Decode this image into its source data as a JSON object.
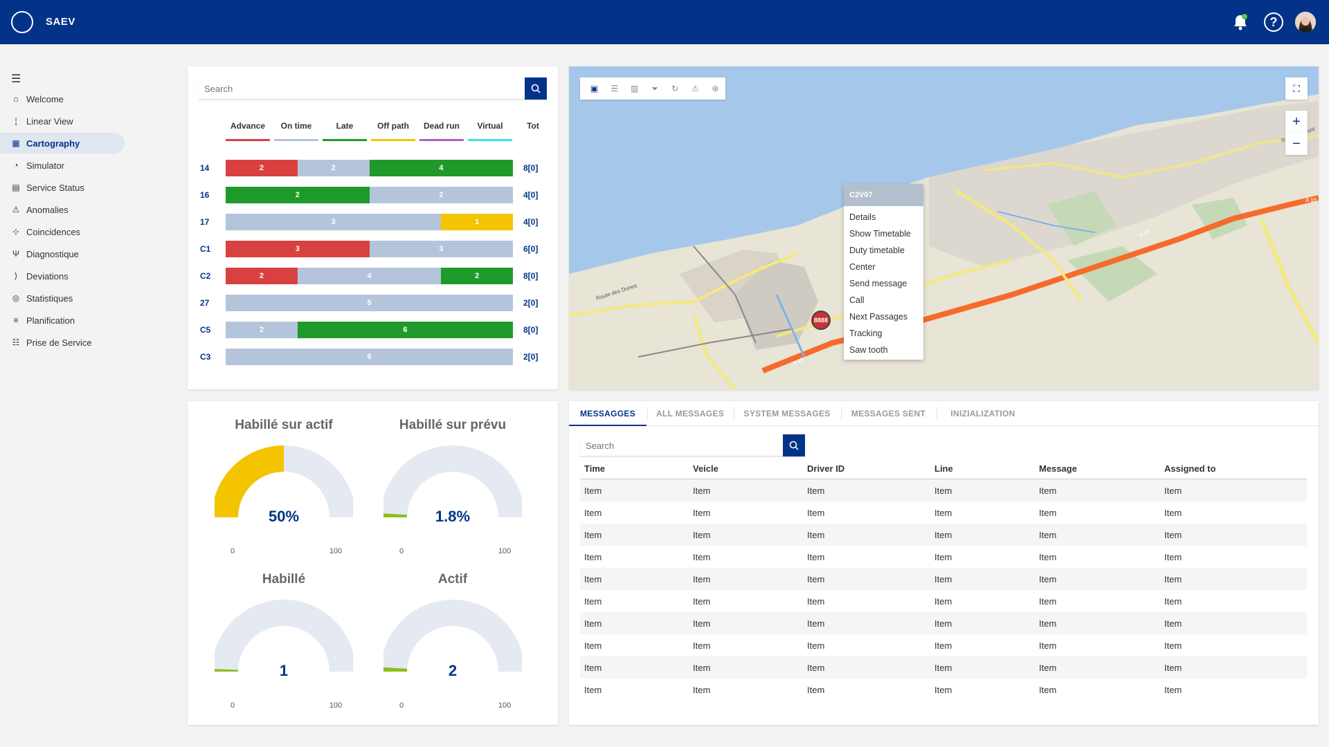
{
  "header": {
    "title": "SAEV",
    "bell_icon": "bell-icon",
    "help_label": "?",
    "help_icon": "help-icon",
    "avatar_icon": "avatar-icon",
    "brand_color": "#033389",
    "notification_dot_color": "#5fc93f"
  },
  "sidebar": {
    "menu_icon": "hamburger-icon",
    "items": [
      {
        "label": "Welcome",
        "icon": "home-icon",
        "glyph": "⌂"
      },
      {
        "label": "Linear View",
        "icon": "linear-view-icon",
        "glyph": "¦"
      },
      {
        "label": "Cartography",
        "icon": "map-icon",
        "glyph": "▦",
        "active": true
      },
      {
        "label": "Simulator",
        "icon": "simulator-icon",
        "glyph": "◔"
      },
      {
        "label": "Service Status",
        "icon": "service-status-icon",
        "glyph": "▤"
      },
      {
        "label": "Anomalies",
        "icon": "warning-icon",
        "glyph": "⚠"
      },
      {
        "label": "Coincidences",
        "icon": "coincidence-icon",
        "glyph": "⊹"
      },
      {
        "label": "Diagnostique",
        "icon": "diagnostic-icon",
        "glyph": "Ψ"
      },
      {
        "label": "Deviations",
        "icon": "deviation-icon",
        "glyph": "⟩"
      },
      {
        "label": "Statistiques",
        "icon": "statistics-icon",
        "glyph": "◎"
      },
      {
        "label": "Planification",
        "icon": "planning-icon",
        "glyph": "≡"
      },
      {
        "label": "Prise de Service",
        "icon": "service-icon",
        "glyph": "☷"
      }
    ]
  },
  "lines_panel": {
    "search_placeholder": "Search",
    "search_icon": "search-icon",
    "legend": [
      {
        "label": "Advance",
        "color": "#d94040"
      },
      {
        "label": "On time",
        "color": "#b4c4db"
      },
      {
        "label": "Late",
        "color": "#1f9a2a"
      },
      {
        "label": "Off path",
        "color": "#f5c400"
      },
      {
        "label": "Dead run",
        "color": "#b05fc9"
      },
      {
        "label": "Virtual",
        "color": "#3de2ea"
      }
    ],
    "tot_header": "Tot",
    "rows": [
      {
        "line": "14",
        "segments": [
          {
            "type": "Advance",
            "value": 2
          },
          {
            "type": "On time",
            "value": 2
          },
          {
            "type": "Late",
            "value": 4
          }
        ],
        "total": "8[0]"
      },
      {
        "line": "16",
        "segments": [
          {
            "type": "Late",
            "value": 2
          },
          {
            "type": "On time",
            "value": 2
          }
        ],
        "total": "4[0]"
      },
      {
        "line": "17",
        "segments": [
          {
            "type": "On time",
            "value": 3
          },
          {
            "type": "Off path",
            "value": 1
          }
        ],
        "total": "4[0]"
      },
      {
        "line": "C1",
        "segments": [
          {
            "type": "Advance",
            "value": 3
          },
          {
            "type": "On time",
            "value": 3
          }
        ],
        "total": "6[0]"
      },
      {
        "line": "C2",
        "segments": [
          {
            "type": "Advance",
            "value": 2
          },
          {
            "type": "On time",
            "value": 4
          },
          {
            "type": "Late",
            "value": 2
          }
        ],
        "total": "8[0]"
      },
      {
        "line": "27",
        "segments": [
          {
            "type": "On time",
            "value": 5
          }
        ],
        "total": "2[0]"
      },
      {
        "line": "C5",
        "segments": [
          {
            "type": "On time",
            "value": 2
          },
          {
            "type": "Late",
            "value": 6
          }
        ],
        "total": "8[0]"
      },
      {
        "line": "C3",
        "segments": [
          {
            "type": "On time",
            "value": 6
          }
        ],
        "total": "2[0]"
      }
    ]
  },
  "gauges": [
    {
      "title": "Habillé sur actif",
      "value_label": "50%",
      "fraction": 0.5,
      "color": "#f5c400",
      "min": "0",
      "max": "100"
    },
    {
      "title": "Habillé sur prévu",
      "value_label": "1.8%",
      "fraction": 0.018,
      "color": "#8bbf1a",
      "min": "0",
      "max": "100"
    },
    {
      "title": "Habillé",
      "value_label": "1",
      "fraction": 0.01,
      "color": "#8bbf1a",
      "min": "0",
      "max": "100"
    },
    {
      "title": "Actif",
      "value_label": "2",
      "fraction": 0.02,
      "color": "#8bbf1a",
      "min": "0",
      "max": "100"
    }
  ],
  "map": {
    "toolbar_icons": [
      "bus-icon",
      "list-icon",
      "columns-icon",
      "filter-icon",
      "refresh-icon",
      "warning-icon",
      "settings-icon"
    ],
    "fullscreen_icon": "fullscreen-icon",
    "zoom_in_label": "+",
    "zoom_out_label": "−",
    "labels": [
      "Route des Dunes",
      "A 16",
      "A 16",
      "Route de Pont",
      "A 16"
    ],
    "vehicle_label": "8888",
    "context_menu": {
      "title": "C2V07",
      "items": [
        "Details",
        "Show Timetable",
        "Duty timetable",
        "Center",
        "Send message",
        "Call",
        "Next Passages",
        "Tracking",
        "Saw tooth"
      ]
    }
  },
  "messages": {
    "tabs": [
      "MESSAGGES",
      "ALL MESSAGES",
      "SYSTEM MESSAGES",
      "MESSAGES SENT",
      "INIZIALIZATION"
    ],
    "active_tab": "MESSAGGES",
    "search_placeholder": "Search",
    "columns": [
      "Time",
      "Veicle",
      "Driver ID",
      "Line",
      "Message",
      "Assigned to"
    ],
    "rows": [
      [
        "Item",
        "Item",
        "Item",
        "Item",
        "Item",
        "Item"
      ],
      [
        "Item",
        "Item",
        "Item",
        "Item",
        "Item",
        "Item"
      ],
      [
        "Item",
        "Item",
        "Item",
        "Item",
        "Item",
        "Item"
      ],
      [
        "Item",
        "Item",
        "Item",
        "Item",
        "Item",
        "Item"
      ],
      [
        "Item",
        "Item",
        "Item",
        "Item",
        "Item",
        "Item"
      ],
      [
        "Item",
        "Item",
        "Item",
        "Item",
        "Item",
        "Item"
      ],
      [
        "Item",
        "Item",
        "Item",
        "Item",
        "Item",
        "Item"
      ],
      [
        "Item",
        "Item",
        "Item",
        "Item",
        "Item",
        "Item"
      ],
      [
        "Item",
        "Item",
        "Item",
        "Item",
        "Item",
        "Item"
      ],
      [
        "Item",
        "Item",
        "Item",
        "Item",
        "Item",
        "Item"
      ]
    ]
  }
}
